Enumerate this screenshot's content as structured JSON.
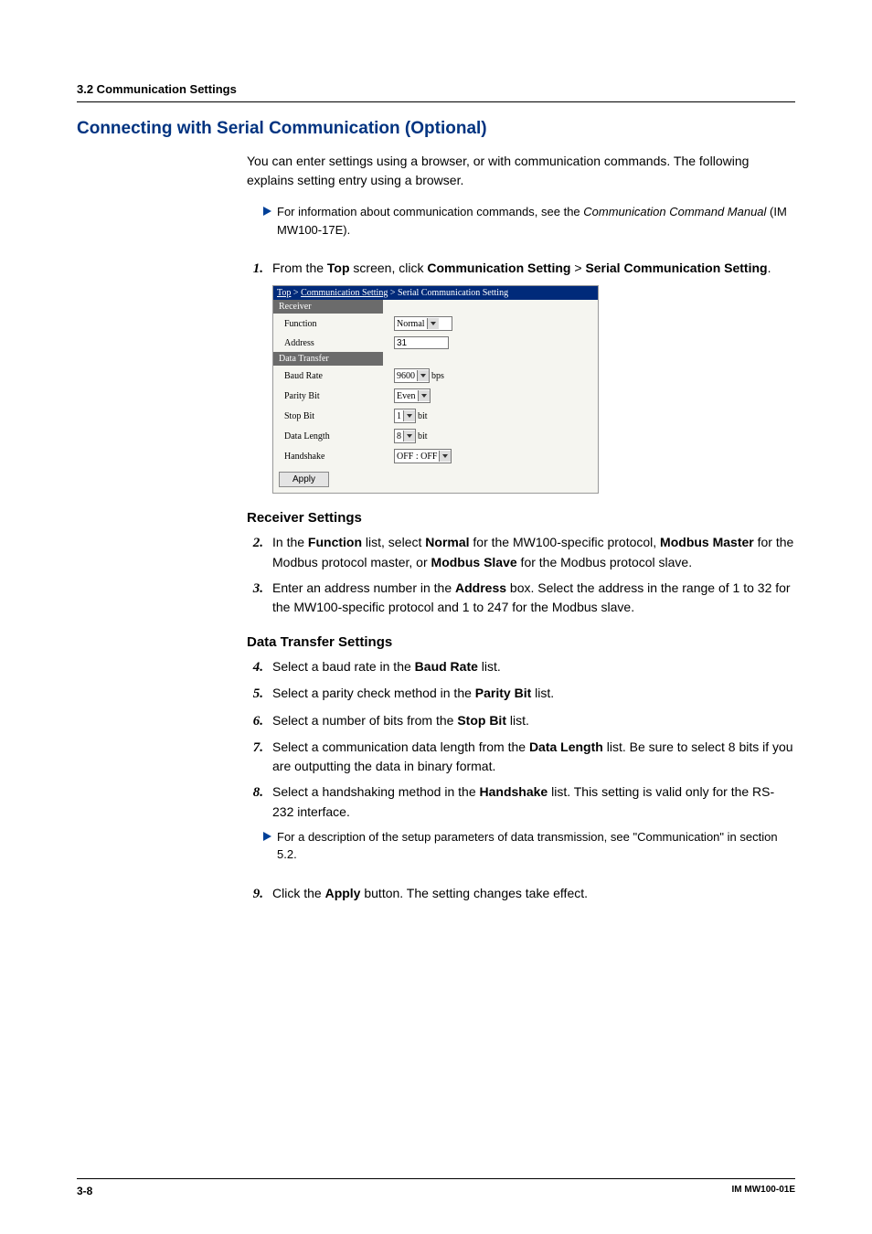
{
  "header": {
    "section": "3.2  Communication Settings"
  },
  "title": "Connecting with Serial Communication (Optional)",
  "intro": "You can enter settings using a browser, or with communication commands. The following explains setting entry using a browser.",
  "note1_a": "For information about communication commands, see the ",
  "note1_i": "Communication Command Manual",
  "note1_b": " (IM MW100-17E).",
  "step1_a": "From the ",
  "step1_b": "Top",
  "step1_c": " screen, click ",
  "step1_d": "Communication Setting",
  "step1_e": " > ",
  "step1_f": "Serial Communication Setting",
  "step1_g": ".",
  "shot": {
    "crumb_top": "Top",
    "crumb_gt1": " > ",
    "crumb_cs": "Communication Setting",
    "crumb_gt2": " > ",
    "crumb_scs": "Serial Communication Setting",
    "sect_receiver": "Receiver",
    "sect_transfer": "Data Transfer",
    "lbl_function": "Function",
    "val_function": "Normal",
    "lbl_address": "Address",
    "val_address": "31",
    "lbl_baud": "Baud Rate",
    "val_baud": "9600",
    "unit_bps": "bps",
    "lbl_parity": "Parity Bit",
    "val_parity": "Even",
    "lbl_stop": "Stop Bit",
    "val_stop": "1",
    "unit_bit": "bit",
    "lbl_datalen": "Data Length",
    "val_datalen": "8",
    "lbl_handshake": "Handshake",
    "val_handshake": "OFF : OFF",
    "btn_apply": "Apply"
  },
  "sub_receiver": "Receiver Settings",
  "step2_a": "In the ",
  "step2_b": "Function",
  "step2_c": " list, select ",
  "step2_d": "Normal",
  "step2_e": " for the MW100-specific protocol, ",
  "step2_f": "Modbus Master",
  "step2_g": " for the Modbus protocol master, or ",
  "step2_h": "Modbus Slave",
  "step2_i": " for the Modbus protocol slave.",
  "step3_a": "Enter an address number in the ",
  "step3_b": "Address",
  "step3_c": " box. Select the address in the range of 1 to 32 for the MW100-specific protocol and 1 to 247 for the Modbus slave.",
  "sub_transfer": "Data Transfer Settings",
  "step4_a": "Select a baud rate in the ",
  "step4_b": "Baud Rate",
  "step4_c": " list.",
  "step5_a": "Select a parity check method in the ",
  "step5_b": "Parity Bit",
  "step5_c": " list.",
  "step6_a": "Select a number of bits from the ",
  "step6_b": "Stop Bit",
  "step6_c": " list.",
  "step7_a": "Select a communication data length from the ",
  "step7_b": "Data Length",
  "step7_c": " list. Be sure to select 8 bits if you are outputting the data in binary format.",
  "step8_a": "Select a handshaking method in the ",
  "step8_b": "Handshake",
  "step8_c": " list. This setting is valid only for the RS-232 interface.",
  "note2": "For a description of the setup parameters of data transmission, see \"Communication\" in section 5.2.",
  "step9_a": "Click the ",
  "step9_b": "Apply",
  "step9_c": " button. The setting changes take effect.",
  "nums": {
    "n1": "1.",
    "n2": "2.",
    "n3": "3.",
    "n4": "4.",
    "n5": "5.",
    "n6": "6.",
    "n7": "7.",
    "n8": "8.",
    "n9": "9."
  },
  "footer": {
    "page": "3-8",
    "doc": "IM MW100-01E"
  }
}
